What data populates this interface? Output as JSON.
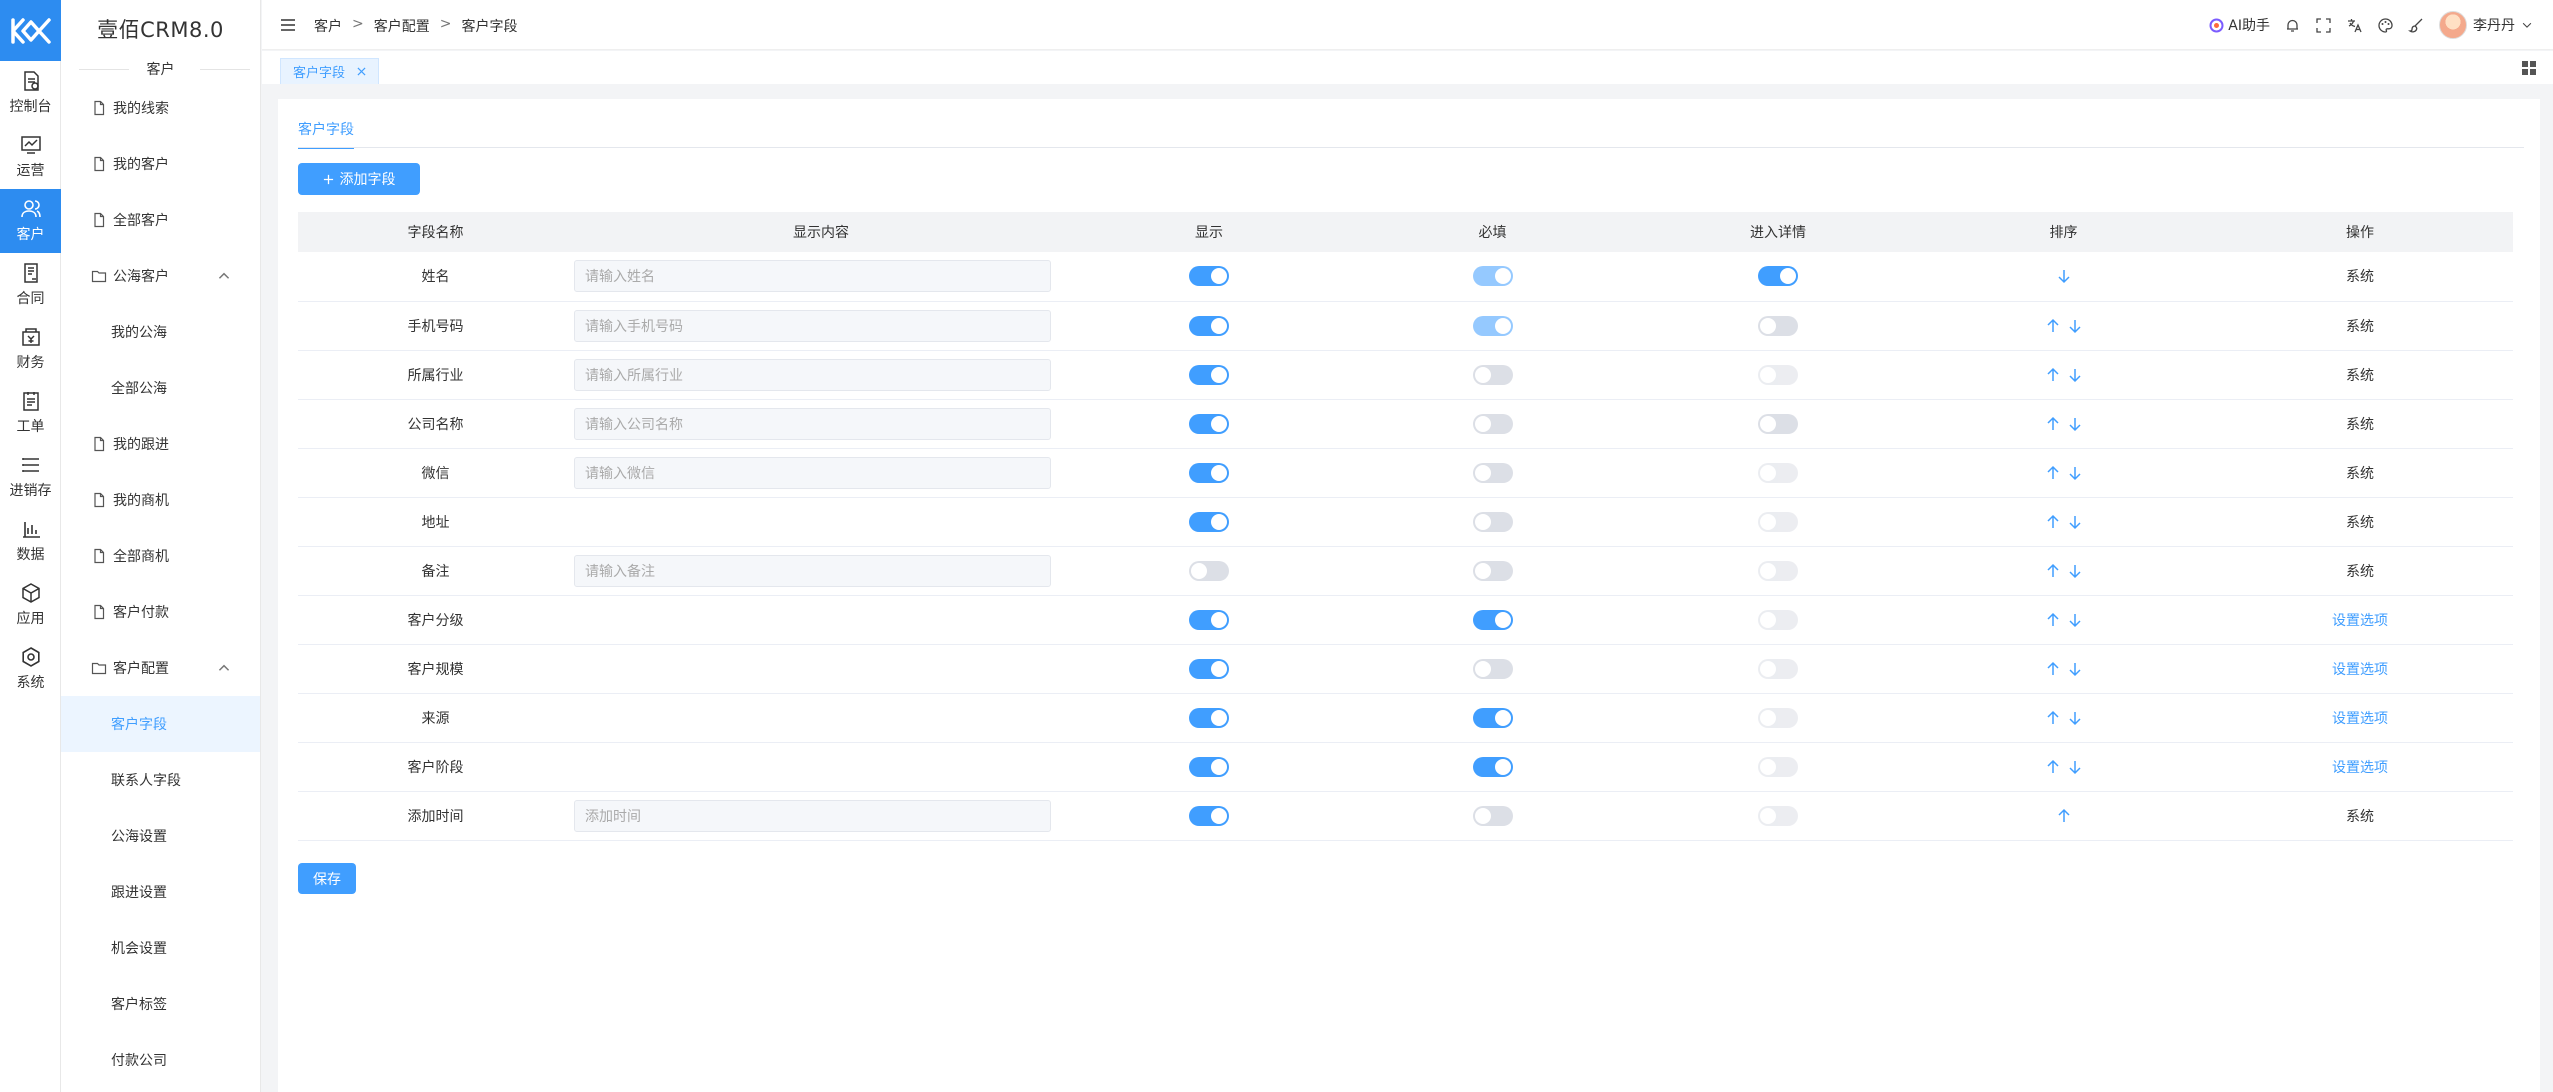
{
  "app": {
    "brand": "壹佰CRM8.0",
    "section_title": "客户"
  },
  "rail": [
    {
      "label": "控制台",
      "icon": "dashboard-icon",
      "active": false
    },
    {
      "label": "运营",
      "icon": "operations-icon",
      "active": false
    },
    {
      "label": "客户",
      "icon": "customer-icon",
      "active": true
    },
    {
      "label": "合同",
      "icon": "contract-icon",
      "active": false
    },
    {
      "label": "财务",
      "icon": "finance-icon",
      "active": false
    },
    {
      "label": "工单",
      "icon": "ticket-icon",
      "active": false
    },
    {
      "label": "进销存",
      "icon": "inventory-icon",
      "active": false
    },
    {
      "label": "数据",
      "icon": "data-icon",
      "active": false
    },
    {
      "label": "应用",
      "icon": "apps-icon",
      "active": false
    },
    {
      "label": "系统",
      "icon": "system-icon",
      "active": false
    }
  ],
  "menu": {
    "my_leads": "我的线索",
    "my_customers": "我的客户",
    "all_customers": "全部客户",
    "public_sea": "公海客户",
    "my_public": "我的公海",
    "all_public": "全部公海",
    "my_followup": "我的跟进",
    "my_opps": "我的商机",
    "all_opps": "全部商机",
    "customer_payment": "客户付款",
    "customer_config": "客户配置",
    "customer_fields": "客户字段",
    "contact_fields": "联系人字段",
    "public_settings": "公海设置",
    "followup_settings": "跟进设置",
    "opportunity_settings": "机会设置",
    "customer_tags": "客户标签",
    "payment_company": "付款公司"
  },
  "breadcrumb": {
    "level1": "客户",
    "level2": "客户配置",
    "level3": "客户字段",
    "sep": ">"
  },
  "header": {
    "ai_label": "AI助手",
    "user_name": "李丹丹"
  },
  "tabs": {
    "active_tab": "客户字段"
  },
  "content": {
    "inner_tab": "客户字段",
    "add_button": "添加字段",
    "save_button": "保存"
  },
  "table": {
    "headers": {
      "name": "字段名称",
      "content": "显示内容",
      "show": "显示",
      "required": "必填",
      "detail": "进入详情",
      "sort": "排序",
      "action": "操作"
    },
    "rows": [
      {
        "name": "姓名",
        "placeholder": "请输入姓名",
        "show": true,
        "required": true,
        "required_disabled": true,
        "detail": true,
        "detail_disabled": false,
        "up": false,
        "down": true,
        "action": "系统",
        "action_link": false
      },
      {
        "name": "手机号码",
        "placeholder": "请输入手机号码",
        "show": true,
        "required": true,
        "required_disabled": true,
        "detail": false,
        "detail_disabled": false,
        "up": true,
        "down": true,
        "action": "系统",
        "action_link": false
      },
      {
        "name": "所属行业",
        "placeholder": "请输入所属行业",
        "show": true,
        "required": false,
        "required_disabled": false,
        "detail": false,
        "detail_disabled": true,
        "up": true,
        "down": true,
        "action": "系统",
        "action_link": false
      },
      {
        "name": "公司名称",
        "placeholder": "请输入公司名称",
        "show": true,
        "required": false,
        "required_disabled": false,
        "detail": false,
        "detail_disabled": false,
        "up": true,
        "down": true,
        "action": "系统",
        "action_link": false
      },
      {
        "name": "微信",
        "placeholder": "请输入微信",
        "show": true,
        "required": false,
        "required_disabled": false,
        "detail": false,
        "detail_disabled": true,
        "up": true,
        "down": true,
        "action": "系统",
        "action_link": false
      },
      {
        "name": "地址",
        "placeholder": "",
        "show": true,
        "required": false,
        "required_disabled": false,
        "detail": false,
        "detail_disabled": true,
        "up": true,
        "down": true,
        "action": "系统",
        "action_link": false
      },
      {
        "name": "备注",
        "placeholder": "请输入备注",
        "show": false,
        "required": false,
        "required_disabled": false,
        "detail": false,
        "detail_disabled": true,
        "up": true,
        "down": true,
        "action": "系统",
        "action_link": false
      },
      {
        "name": "客户分级",
        "placeholder": "",
        "show": true,
        "required": true,
        "required_disabled": false,
        "detail": false,
        "detail_disabled": true,
        "up": true,
        "down": true,
        "action": "设置选项",
        "action_link": true
      },
      {
        "name": "客户规模",
        "placeholder": "",
        "show": true,
        "required": false,
        "required_disabled": false,
        "detail": false,
        "detail_disabled": true,
        "up": true,
        "down": true,
        "action": "设置选项",
        "action_link": true
      },
      {
        "name": "来源",
        "placeholder": "",
        "show": true,
        "required": true,
        "required_disabled": false,
        "detail": false,
        "detail_disabled": true,
        "up": true,
        "down": true,
        "action": "设置选项",
        "action_link": true
      },
      {
        "name": "客户阶段",
        "placeholder": "",
        "show": true,
        "required": true,
        "required_disabled": false,
        "detail": false,
        "detail_disabled": true,
        "up": true,
        "down": true,
        "action": "设置选项",
        "action_link": true
      },
      {
        "name": "添加时间",
        "placeholder": "添加时间",
        "show": true,
        "required": false,
        "required_disabled": false,
        "detail": false,
        "detail_disabled": true,
        "up": true,
        "down": false,
        "action": "系统",
        "action_link": false
      }
    ]
  },
  "colors": {
    "primary": "#409eff",
    "rail_active": "#2d8cf0",
    "switch_off": "#dcdfe6"
  }
}
